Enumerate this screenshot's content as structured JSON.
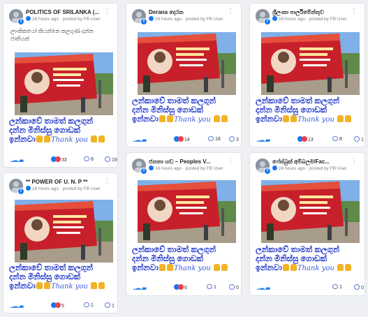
{
  "colors": {
    "page_bg": "#eef0f3",
    "card_bg": "#ffffff",
    "poster_text": "#1c33c8",
    "fb_blue": "#1877f2",
    "love_red": "#e9404f",
    "banner_red": "#c8202a"
  },
  "icons": {
    "platform": "facebook-icon",
    "menu": "more-dots-icon",
    "comment": "comment-icon",
    "share": "share-icon",
    "reactions": [
      "like-reaction-icon",
      "love-reaction-icon"
    ]
  },
  "poster": {
    "line1": "ලන්කාවේ තාමත් කලගුන්",
    "line2": "දන්න මිනිස්සු ගොඩක්",
    "line3": "ඉන්නවා",
    "thanks": "Thank you"
  },
  "cards": [
    {
      "title": "POLITICS OF SRILANKA (...",
      "time": "16 hours ago",
      "posted_by": "posted by FB User",
      "caption": "ලාංකිකයෝ කියන්නෙ කලගුණ දන්න ජාතියක්",
      "reactions": "33",
      "comments": "8",
      "shares": "19"
    },
    {
      "title": "Derana දෙරන",
      "time": "16 hours ago",
      "posted_by": "posted by FB User",
      "caption": "",
      "reactions": "14",
      "comments": "18",
      "shares": "3"
    },
    {
      "title": "ශ්‍රීලංකා පාර්ලිමේන්තුව",
      "time": "16 hours ago",
      "posted_by": "posted by FB User",
      "caption": "",
      "reactions": "13",
      "comments": "8",
      "shares": "1"
    },
    {
      "title": "** POWER OF U. N. P **",
      "time": "16 hours ago",
      "posted_by": "posted by FB User",
      "caption": "",
      "reactions": "5",
      "comments": "1",
      "shares": "1"
    },
    {
      "title": "ජනතා හඩ – Peoples V...",
      "time": "16 hours ago",
      "posted_by": "posted by FB User",
      "caption": "",
      "reactions": "6",
      "comments": "1",
      "shares": "0"
    },
    {
      "title": "ෆේස්බුක් අම්බලම/Fac...",
      "time": "16 hours ago",
      "posted_by": "posted by FB User",
      "caption": "",
      "reactions": "",
      "comments": "1",
      "shares": "0"
    }
  ]
}
